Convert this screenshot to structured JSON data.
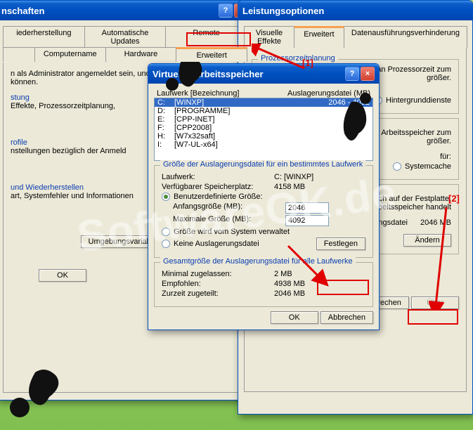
{
  "watermark": "SoftwareOK.de",
  "annotations": {
    "num1": "[1]",
    "num2": "[2]"
  },
  "props": {
    "title": "nschaften",
    "tabs_top": [
      "iederherstellung",
      "Automatische Updates",
      "Remote"
    ],
    "tabs_bot": [
      "",
      "Computername",
      "Hardware",
      "Erweitert"
    ],
    "admintext": "n als Administrator angemeldet sein, und diese Änderungen zu können.",
    "leistung_h": "stung",
    "leistung_t": "Effekte, Prozessorzeitplanung,",
    "profile_h": "rofile",
    "profile_t": "nstellungen bezüglich der Anmeld",
    "starten_h": "und Wiederherstellen",
    "starten_t": "art, Systemfehler und Informationen",
    "envbtn": "Umgebungsvariablen",
    "ok": "OK"
  },
  "perf": {
    "title": "Leistungsoptionen",
    "tabs": [
      "Visuelle Effekte",
      "Erweitert",
      "Datenausführungsverhinderung"
    ],
    "cpu_legend": "Prozessorzeitplanung",
    "cpu_t1": "nteil an Prozessorzeit zum",
    "cpu_t2": "größer.",
    "cpu_opt": "Hintergrunddienste",
    "mem_t1": "an Arbeitsspeicher zum",
    "mem_t2": "größer.",
    "mem_for": "für:",
    "mem_opt": "Systemcache",
    "vm_t1": "ein Bereich auf der Festplatte,",
    "vm_t2": "es sich um Arbeitsspeicher handelt",
    "vm_lbl": "ngsdatei",
    "vm_size": "2046 MB",
    "changebtn": "Ändern",
    "ok": "OK",
    "cancel": "Abbrechen",
    "apply": "Über"
  },
  "vm": {
    "title": "Virtueller Arbeitsspeicher",
    "hdr_drive": "Laufwerk [Bezeichnung]",
    "hdr_pf": "Auslagerungsdatei (MB)",
    "drives": [
      {
        "l": "C:",
        "n": "[WINXP]",
        "p": "2046 - 4092"
      },
      {
        "l": "D:",
        "n": "[PROGRAMME]",
        "p": ""
      },
      {
        "l": "E:",
        "n": "[CPP-INET]",
        "p": ""
      },
      {
        "l": "F:",
        "n": "[CPP2008]",
        "p": ""
      },
      {
        "l": "H:",
        "n": "[W7x32saft]",
        "p": ""
      },
      {
        "l": "I:",
        "n": "[W7-UL-x64]",
        "p": ""
      }
    ],
    "grp1_legend": "Größe der Auslagerungsdatei für ein bestimmtes Laufwerk",
    "drive_lbl": "Laufwerk:",
    "drive_val": "C:  [WINXP]",
    "free_lbl": "Verfügbarer Speicherplatz:",
    "free_val": "4158 MB",
    "r_custom": "Benutzerdefinierte Größe:",
    "min_lbl": "Anfangsgröße (MB):",
    "min_val": "2046",
    "max_lbl": "Maximale Größe (MB):",
    "max_val": "4092",
    "r_system": "Größe wird vom System verwaltet",
    "r_none": "Keine Auslagerungsdatei",
    "setbtn": "Festlegen",
    "grp2_legend": "Gesamtgröße der Auslagerungsdatei für alle Laufwerke",
    "tot_min_lbl": "Minimal zugelassen:",
    "tot_min_val": "2 MB",
    "tot_rec_lbl": "Empfohlen:",
    "tot_rec_val": "4938 MB",
    "tot_cur_lbl": "Zurzeit zugeteilt:",
    "tot_cur_val": "2046 MB",
    "ok": "OK",
    "cancel": "Abbrechen"
  }
}
